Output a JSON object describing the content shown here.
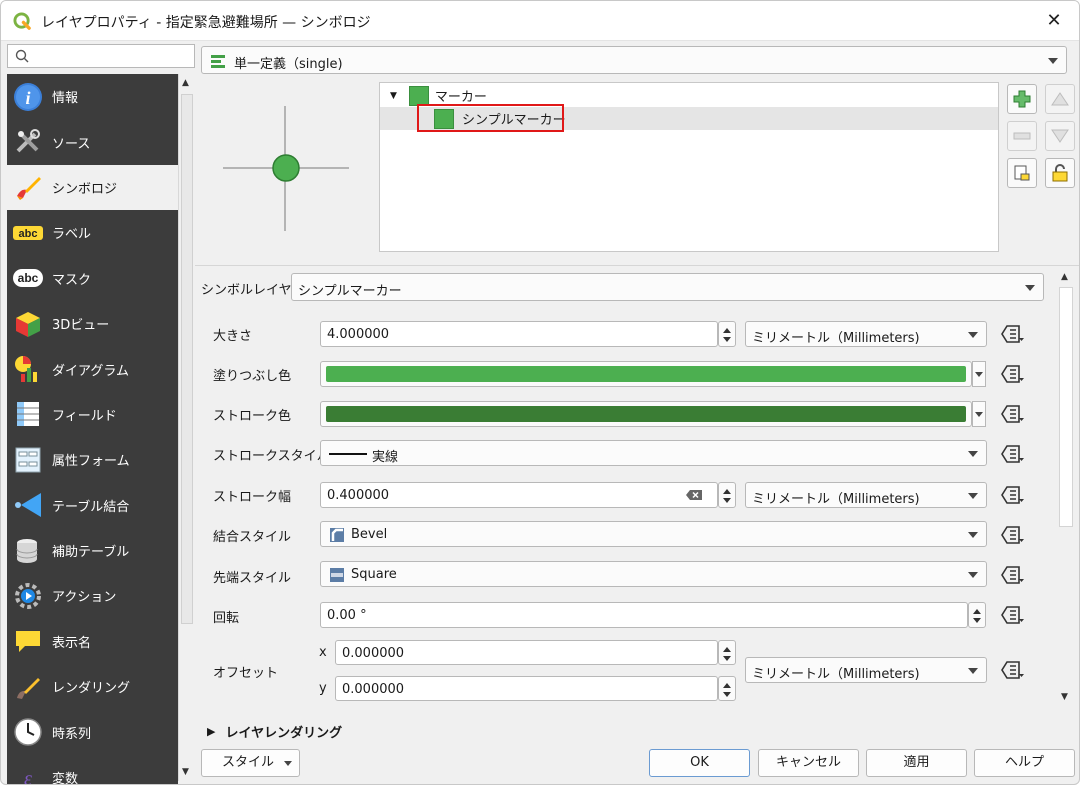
{
  "window": {
    "title": "レイヤプロパティ - 指定緊急避難場所 — シンボロジ"
  },
  "sidebar": {
    "items": [
      {
        "label": "情報",
        "icon": "info-icon"
      },
      {
        "label": "ソース",
        "icon": "source-tools-icon"
      },
      {
        "label": "シンボロジ",
        "icon": "symbology-brush-icon",
        "active": true
      },
      {
        "label": "ラベル",
        "icon": "labels-abc-icon"
      },
      {
        "label": "マスク",
        "icon": "mask-abc-icon"
      },
      {
        "label": "3Dビュー",
        "icon": "3d-view-icon"
      },
      {
        "label": "ダイアグラム",
        "icon": "diagram-icon"
      },
      {
        "label": "フィールド",
        "icon": "fields-icon"
      },
      {
        "label": "属性フォーム",
        "icon": "attribute-form-icon"
      },
      {
        "label": "テーブル結合",
        "icon": "table-join-icon"
      },
      {
        "label": "補助テーブル",
        "icon": "auxiliary-table-icon"
      },
      {
        "label": "アクション",
        "icon": "actions-gear-icon"
      },
      {
        "label": "表示名",
        "icon": "display-name-icon"
      },
      {
        "label": "レンダリング",
        "icon": "rendering-brush-icon"
      },
      {
        "label": "時系列",
        "icon": "temporal-clock-icon"
      },
      {
        "label": "変数",
        "icon": "variables-icon"
      }
    ]
  },
  "renderer": {
    "selected": "単一定義（single)"
  },
  "symbol_tree": {
    "root": "マーカー",
    "child": "シンプルマーカー"
  },
  "symbol_layer_type": {
    "label": "シンボルレイヤ型",
    "value": "シンプルマーカー"
  },
  "properties": {
    "size": {
      "label": "大きさ",
      "value": "4.000000",
      "unit": "ミリメートル（Millimeters)"
    },
    "fill_color": {
      "label": "塗りつぶし色",
      "color": "#4caf50"
    },
    "stroke_color": {
      "label": "ストローク色",
      "color": "#3a7d34"
    },
    "stroke_style": {
      "label": "ストロークスタイル",
      "value": "実線"
    },
    "stroke_width": {
      "label": "ストローク幅",
      "value": "0.400000",
      "unit": "ミリメートル（Millimeters)"
    },
    "join_style": {
      "label": "結合スタイル",
      "value": "Bevel"
    },
    "cap_style": {
      "label": "先端スタイル",
      "value": "Square"
    },
    "rotation": {
      "label": "回転",
      "value": "0.00 °"
    },
    "offset": {
      "label": "オフセット",
      "x_label": "x",
      "x_value": "0.000000",
      "y_label": "y",
      "y_value": "0.000000",
      "unit": "ミリメートル（Millimeters)"
    }
  },
  "layer_rendering": {
    "label": "レイヤレンダリング"
  },
  "buttons": {
    "style": "スタイル",
    "ok": "OK",
    "cancel": "キャンセル",
    "apply": "適用",
    "help": "ヘルプ"
  },
  "colors": {
    "marker_fill": "#4caf50",
    "highlight": "#e01818"
  }
}
